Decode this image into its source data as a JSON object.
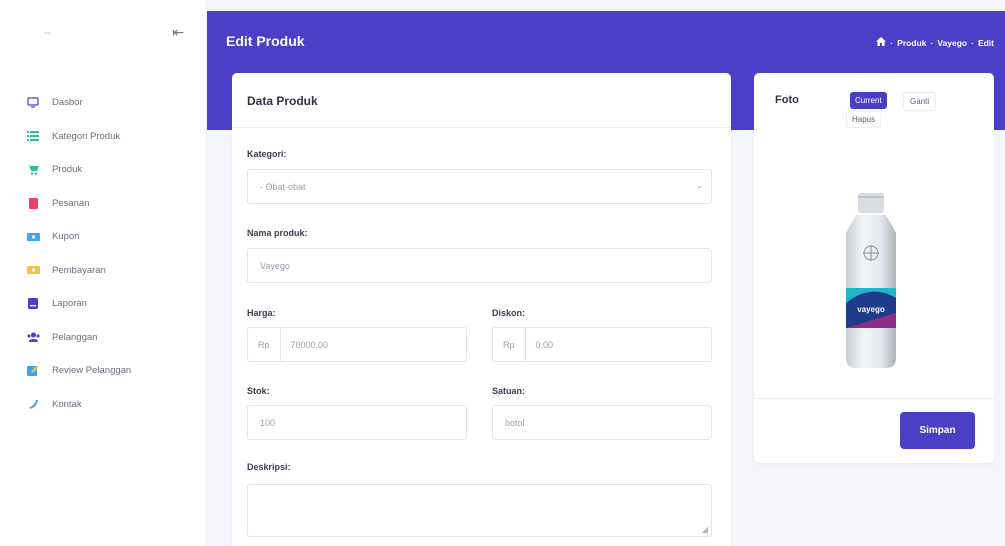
{
  "sidebar": {
    "toggle_icon": "menu-collapse-icon",
    "items": [
      {
        "label": "Dasbor",
        "icon": "monitor-icon",
        "color": "#4a3fc7"
      },
      {
        "label": "Kategori Produk",
        "icon": "list-icon",
        "color": "#2dc09b"
      },
      {
        "label": "Produk",
        "icon": "cart-icon",
        "color": "#2dc09b"
      },
      {
        "label": "Pesanan",
        "icon": "receipt-icon",
        "color": "#e8446a"
      },
      {
        "label": "Kupon",
        "icon": "ticket-icon",
        "color": "#3aa7e8"
      },
      {
        "label": "Pembayaran",
        "icon": "money-icon",
        "color": "#f5c242"
      },
      {
        "label": "Laporan",
        "icon": "report-icon",
        "color": "#4a3fc7"
      },
      {
        "label": "Pelanggan",
        "icon": "users-icon",
        "color": "#4a3fc7"
      },
      {
        "label": "Review Pelanggan",
        "icon": "review-icon",
        "color": "#3aa7e8"
      },
      {
        "label": "Kontak",
        "icon": "phone-icon",
        "color": "#3aa7e8"
      }
    ]
  },
  "header": {
    "title": "Edit Produk",
    "breadcrumb": [
      "Produk",
      "Vayego",
      "Edit"
    ],
    "accent": "#4a3fc7"
  },
  "form": {
    "title": "Data Produk",
    "kategori": {
      "label": "Kategori:",
      "value": "- Obat-obat"
    },
    "nama": {
      "label": "Nama produk:",
      "value": "Vayego"
    },
    "harga": {
      "label": "Harga:",
      "prefix": "Rp",
      "value": "70000.00"
    },
    "diskon": {
      "label": "Diskon:",
      "prefix": "Rp",
      "value": "0.00"
    },
    "stok": {
      "label": "Stok:",
      "value": "100"
    },
    "satuan": {
      "label": "Satuan:",
      "value": "botol"
    },
    "deskripsi": {
      "label": "Deskripsi:",
      "value": ""
    }
  },
  "photo": {
    "title": "Foto",
    "current_label": "Current",
    "ganti_label": "Ganti",
    "hapus_label": "Hapus",
    "product_image_label": "vayego",
    "save_label": "Simpan"
  }
}
